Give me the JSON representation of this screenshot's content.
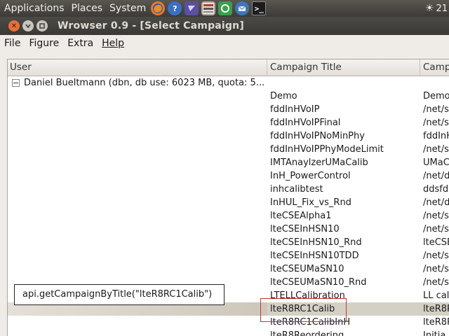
{
  "panel": {
    "menus": [
      "Applications",
      "Places",
      "System"
    ],
    "launchers": [
      {
        "icon": "firefox-icon",
        "color": "#e8782a"
      },
      {
        "icon": "help-icon",
        "color": "#3b6fc4"
      },
      {
        "icon": "eclipse-icon",
        "color": "#5b4fa0"
      },
      {
        "icon": "openwns-icon",
        "color": "#b0aba2"
      },
      {
        "icon": "recycle-icon",
        "color": "#3aa04a"
      },
      {
        "icon": "thunderbird-icon",
        "color": "#3f76b8"
      },
      {
        "icon": "terminal-icon",
        "color": "#1c1c1c"
      }
    ],
    "clock": "21"
  },
  "window": {
    "title": "Wrowser 0.9 - [Select Campaign]"
  },
  "menubar": [
    "File",
    "Figure",
    "Extra",
    "Help"
  ],
  "tree": {
    "columns": [
      "User",
      "Campaign Title",
      "Camp"
    ],
    "user": "Daniel Bueltmann (dbn, db use: 6023 MB, quota: 5...",
    "rows": [
      {
        "title": "Demo",
        "path": "Demo"
      },
      {
        "title": "fddInHVoIP",
        "path": "/net/s"
      },
      {
        "title": "fddInHVoIPFinal",
        "path": "/net/s"
      },
      {
        "title": "fddInHVoIPNoMinPhy",
        "path": "fddInH"
      },
      {
        "title": "fddInHVoIPPhyModeLimit",
        "path": "/net/s"
      },
      {
        "title": "IMTAnaylzerUMaCalib",
        "path": "UMaC"
      },
      {
        "title": "InH_PowerControl",
        "path": "/net/d"
      },
      {
        "title": "inhcalibtest",
        "path": "ddsfds"
      },
      {
        "title": "InHUL_Fix_vs_Rnd",
        "path": "/net/d"
      },
      {
        "title": "lteCSEAlpha1",
        "path": "/net/s"
      },
      {
        "title": "lteCSEInHSN10",
        "path": "/net/s"
      },
      {
        "title": "lteCSEInHSN10_Rnd",
        "path": "lteCSE"
      },
      {
        "title": "lteCSEInHSN10TDD",
        "path": "/net/s"
      },
      {
        "title": "lteCSEUMaSN10",
        "path": "/net/s"
      },
      {
        "title": "lteCSEUMaSN10_Rnd",
        "path": "/net/s"
      },
      {
        "title": "LTELLCalibration",
        "path": "LL cal"
      },
      {
        "title": "lteR8RC1Calib",
        "path": "lteR8R"
      },
      {
        "title": "lteR8RC1CalibInH",
        "path": "lteR8R"
      },
      {
        "title": "lteR8Reordering",
        "path": "Initia"
      }
    ],
    "selected_index": 16
  },
  "annotation": {
    "callout": "api.getCampaignByTitle(\"lteR8RC1Calib\")",
    "highlight_color": "#d03030"
  }
}
